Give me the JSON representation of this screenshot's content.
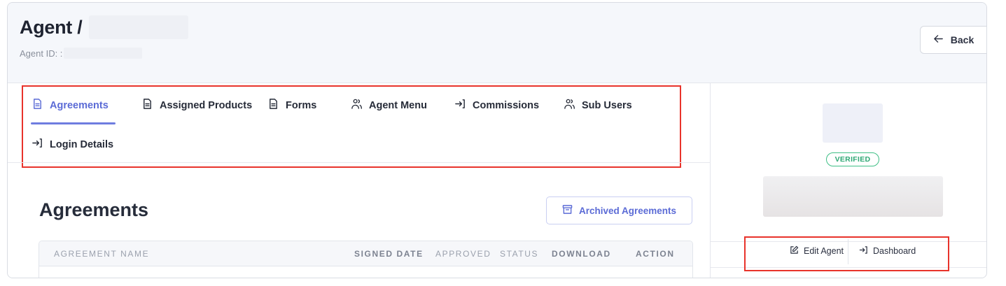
{
  "header": {
    "title": "Agent /",
    "agent_id_label": "Agent ID: :",
    "back_label": "Back"
  },
  "tabs": [
    {
      "label": "Agreements",
      "icon": "document-icon",
      "active": true
    },
    {
      "label": "Assigned Products",
      "icon": "document-icon",
      "active": false
    },
    {
      "label": "Forms",
      "icon": "document-icon",
      "active": false
    },
    {
      "label": "Agent Menu",
      "icon": "users-icon",
      "active": false
    },
    {
      "label": "Commissions",
      "icon": "login-arrow-icon",
      "active": false
    },
    {
      "label": "Sub Users",
      "icon": "users-icon",
      "active": false
    },
    {
      "label": "Login Details",
      "icon": "login-arrow-icon",
      "active": false
    }
  ],
  "section": {
    "title": "Agreements",
    "archived_label": "Archived Agreements"
  },
  "table": {
    "columns": [
      "AGREEMENT NAME",
      "SIGNED DATE",
      "APPROVED",
      "STATUS",
      "DOWNLOAD",
      "ACTION"
    ],
    "rows": []
  },
  "side": {
    "badge": "VERIFIED",
    "edit_label": "Edit Agent",
    "dashboard_label": "Dashboard"
  },
  "colors": {
    "accent": "#5b6bd6",
    "verified": "#2ea874",
    "highlight_box": "#e8332b"
  }
}
